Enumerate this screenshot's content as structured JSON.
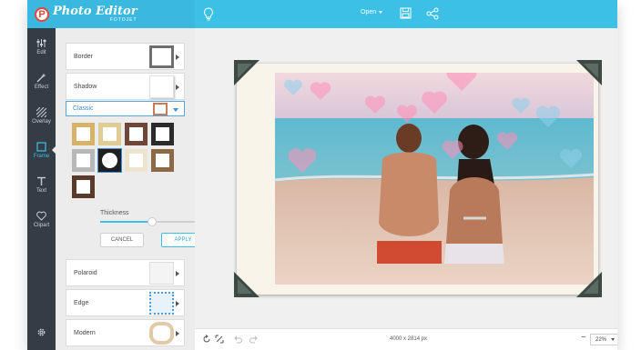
{
  "app": {
    "brand_letter": "P",
    "brand_title": "Photo Editor",
    "brand_sub": "FOTOJET",
    "accent_color": "#3dc0e6"
  },
  "topbar": {
    "open_label": "Open"
  },
  "nav": {
    "items": [
      {
        "label": "Edit",
        "icon": "sliders-icon"
      },
      {
        "label": "Effect",
        "icon": "magic-wand-icon"
      },
      {
        "label": "Overlay",
        "icon": "hatch-icon"
      },
      {
        "label": "Frame",
        "icon": "square-icon",
        "active": true
      },
      {
        "label": "Text",
        "icon": "text-t-icon"
      },
      {
        "label": "Clipart",
        "icon": "heart-icon"
      }
    ],
    "settings_icon": "gear-icon"
  },
  "panel": {
    "rows_top": [
      {
        "label": "Border"
      },
      {
        "label": "Shadow"
      }
    ],
    "dropdown_selected": "Classic",
    "thickness_label": "Thickness",
    "thickness_value": "50",
    "thickness_fraction": 0.5,
    "cancel_label": "CANCEL",
    "apply_label": "APPLY",
    "rows_bottom": [
      {
        "label": "Polaroid"
      },
      {
        "label": "Edge"
      },
      {
        "label": "Modern"
      }
    ],
    "frame_swatches": [
      {
        "name": "gold-frame",
        "color": "#d7b36a"
      },
      {
        "name": "light-gold-frame",
        "color": "#e0cd96"
      },
      {
        "name": "brown-wood-frame",
        "color": "#6e4536"
      },
      {
        "name": "black-frame",
        "color": "#2b2b2b"
      },
      {
        "name": "silver-frame",
        "color": "#b8b8b8"
      },
      {
        "name": "black-ornate-frame",
        "color": "#1f1f1f"
      },
      {
        "name": "cream-frame",
        "color": "#ece4cf"
      },
      {
        "name": "bronze-frame",
        "color": "#8d6a45"
      },
      {
        "name": "dark-wood-frame",
        "color": "#5a3a2a"
      }
    ]
  },
  "canvas": {
    "image_size": "4000 x 2814 px",
    "zoom": "22%"
  }
}
